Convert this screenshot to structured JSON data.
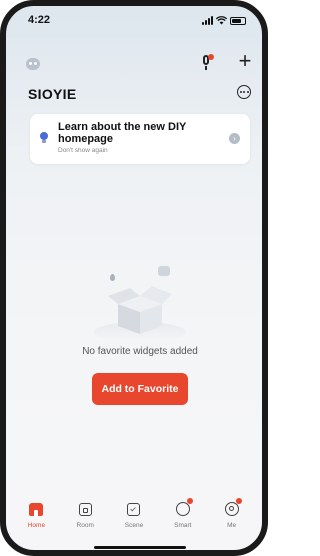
{
  "status_bar": {
    "time": "4:22",
    "signal_icon": "cellular-signal-icon",
    "wifi_icon": "wifi-icon",
    "battery_icon": "battery-icon"
  },
  "header": {
    "home_name": "SIOYIE",
    "assistant_icon": "robot-icon",
    "mic_icon": "microphone-icon",
    "add_icon": "plus-icon",
    "more_icon": "ellipsis-circle-icon"
  },
  "banner": {
    "title": "Learn about the new DIY homepage",
    "subtitle": "Don't show again",
    "icon": "lightbulb-icon",
    "arrow_icon": "chevron-right-icon"
  },
  "empty_state": {
    "message": "No favorite widgets added",
    "button_label": "Add to Favorite",
    "illustration_icon": "empty-box-icon"
  },
  "tabs": [
    {
      "label": "Home",
      "icon": "home-icon",
      "active": true,
      "badge": false
    },
    {
      "label": "Room",
      "icon": "room-icon",
      "active": false,
      "badge": false
    },
    {
      "label": "Scene",
      "icon": "scene-icon",
      "active": false,
      "badge": false
    },
    {
      "label": "Smart",
      "icon": "smart-icon",
      "active": false,
      "badge": true
    },
    {
      "label": "Me",
      "icon": "profile-icon",
      "active": false,
      "badge": true
    }
  ],
  "colors": {
    "accent": "#e8472d",
    "background": "#eef1f4"
  }
}
